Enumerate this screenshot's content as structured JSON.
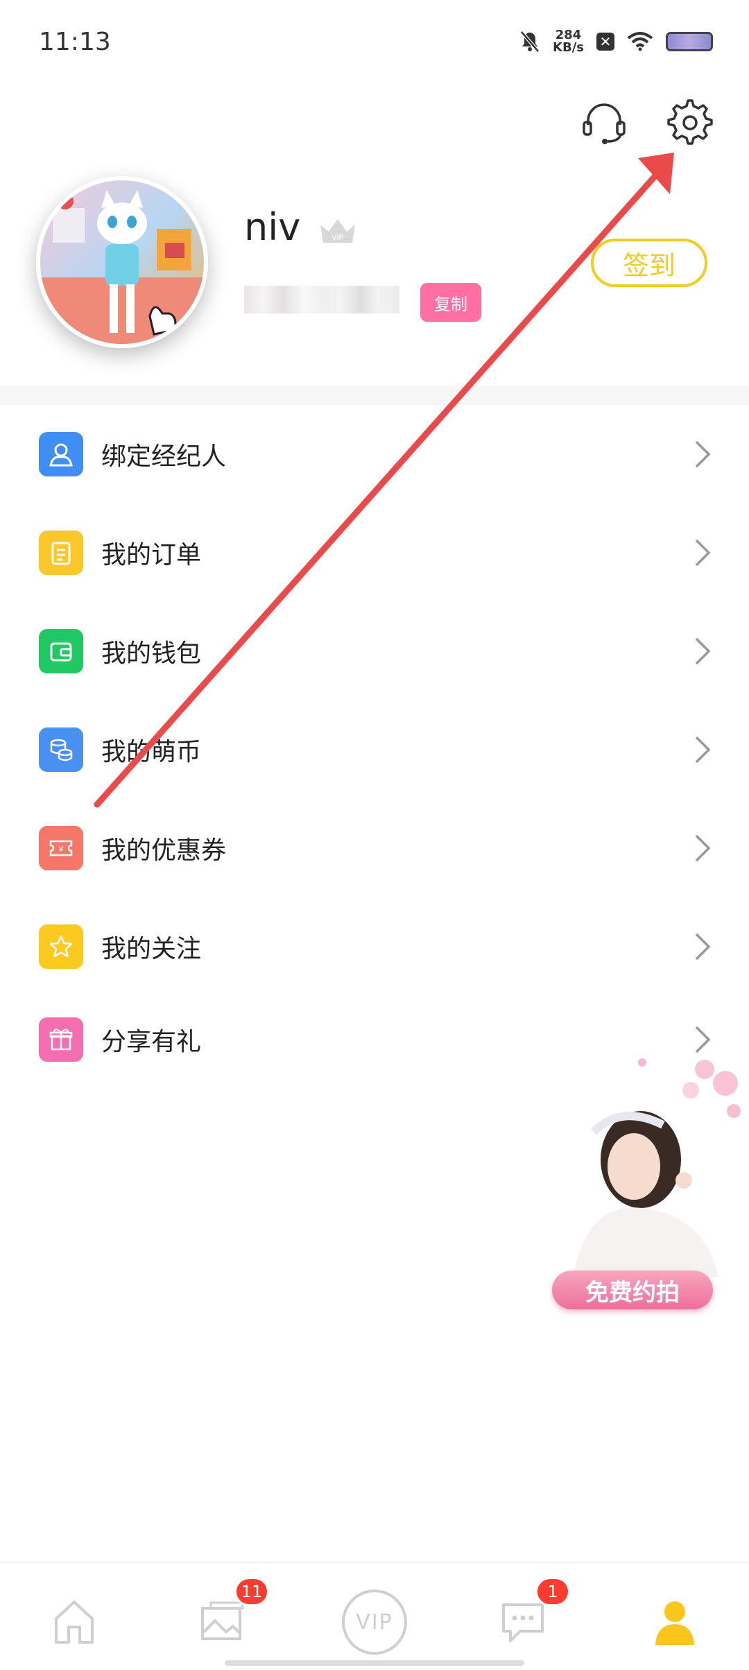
{
  "status_bar": {
    "time": "11:13",
    "speed_value": "284",
    "speed_unit": "KB/s",
    "sim_badge": "✕",
    "icons": [
      "mute-bell-icon",
      "sim-off-icon",
      "wifi-icon",
      "battery-icon"
    ]
  },
  "header": {
    "icons": [
      "headset-support-icon",
      "settings-gear-icon"
    ]
  },
  "profile": {
    "username": "niv",
    "vip_badge": "VIP",
    "copy_label": "复制",
    "checkin_label": "签到"
  },
  "menu": {
    "items": [
      {
        "label": "绑定经纪人",
        "icon": "person-icon",
        "color": "#3f8ef4"
      },
      {
        "label": "我的订单",
        "icon": "order-list-icon",
        "color": "#fbc72a"
      },
      {
        "label": "我的钱包",
        "icon": "wallet-icon",
        "color": "#20c763"
      },
      {
        "label": "我的萌币",
        "icon": "coins-icon",
        "color": "#4a8ff2"
      },
      {
        "label": "我的优惠券",
        "icon": "coupon-icon",
        "color": "#f5776a"
      },
      {
        "label": "我的关注",
        "icon": "star-icon",
        "color": "#fcc91f"
      },
      {
        "label": "分享有礼",
        "icon": "gift-icon",
        "color": "#f46fb0"
      }
    ]
  },
  "promo": {
    "label": "免费约拍"
  },
  "bottom_nav": {
    "items": [
      {
        "name": "home",
        "icon": "home-icon"
      },
      {
        "name": "gallery",
        "icon": "gallery-icon",
        "badge": "11"
      },
      {
        "name": "vip",
        "icon": "vip-circle-icon",
        "label": "VIP"
      },
      {
        "name": "messages",
        "icon": "chat-icon",
        "badge": "1"
      },
      {
        "name": "profile",
        "icon": "user-icon",
        "active": true
      }
    ],
    "active_color": "#fbc61c",
    "inactive_color": "#cfcfcf"
  },
  "annotation": {
    "arrow_color": "#ea4a4a"
  }
}
